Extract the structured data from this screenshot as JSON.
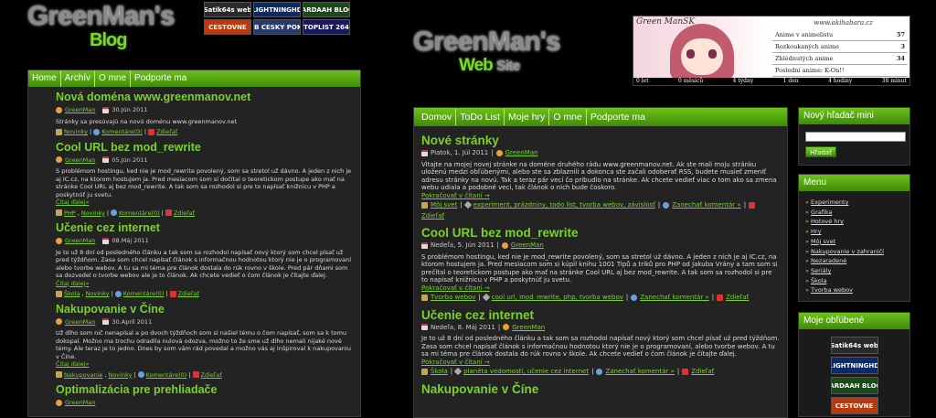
{
  "left": {
    "logo": {
      "line1": "GreenMan's",
      "line2": "Blog"
    },
    "badges": [
      "Satik64s web",
      "LIGHTNINGHD",
      "JARDAAH BLOG",
      "CESTOVNE",
      "WEB CESKY POKER",
      "TOPLIST 264"
    ],
    "nav": [
      "Home",
      "Archív",
      "O mne",
      "Podporte ma"
    ],
    "posts": [
      {
        "title": "Nová doména www.greenmanov.net",
        "author": "GreenMan",
        "date": "30.Jún 2011",
        "text": "Stránky sa presúvajú na novú doménu www.greenmanov.net",
        "link": "",
        "tags": [
          "Novinky",
          "Komentáre(0)",
          "Zdieľať"
        ]
      },
      {
        "title": "Cool URL bez mod_rewrite",
        "author": "GreenMan",
        "date": "05.Jún 2011",
        "text": "S problémom hostingu, ked nie je mod_rewrite povolený, som sa stretol už dávno. A jeden z nich je aj IC.cz, na ktorom hostujem ja. Pred mesiacom som si dočítal o teoretickom postupe ako mať na stránke Cool URL aj bez mod_rewrite. A tak som sa rozhodol si pre to napísať knižnicu v PHP a poskytnúť ju svetu.",
        "link": "Čítaj ďalej»",
        "tags": [
          "PHP",
          "Novinky",
          "Komentáre(0)",
          "Zdieľať"
        ]
      },
      {
        "title": "Učenie cez internet",
        "author": "GreenMan",
        "date": "08.Máj 2011",
        "text": "Je to už 8 dní od posledného článku a tak som sa rozhodol napísať nový ktorý som chcel písať už pred týždňom. Zasa som chcel napísať článok s informačnou hodnotou ktorý nie je o programovaní alebo tvorbe webov. A tu sa mi téma pre článok dostala do rúk rovno v škole. Pred pár dňami som sa dozvedel o tvorbe webov ale je to článok. Ak chcete vedieť o čom článok je čítajte ďalej.",
        "link": "Čítaj ďalej»",
        "tags": [
          "Škola",
          "Novinky",
          "Komentáre(0)",
          "Zdieľať"
        ]
      },
      {
        "title": "Nakupovanie v Číne",
        "author": "GreenMan",
        "date": "30.Apríl 2011",
        "text": "Už dlho som nič nenapísal a po dvoch týždňoch som si našiel tému o čom napísať, som sa k tomu dokopal. Možno ma trochu odradila nulová odozva, možno to že sme už dlho nemali nijaké nové témy. Ale teraz je to jedno. Dnes by som vám rád povedal a možno vás aj inšpiroval k nakupovaniu v Číne.",
        "link": "Čítaj ďalej»",
        "tags": [
          "Nakupovanie",
          "Novinky",
          "Komentáre(0)",
          "Zdieľať"
        ]
      },
      {
        "title": "Optimalizácia pre prehliadače",
        "author": "GreenMan",
        "date": "",
        "text": "",
        "link": "",
        "tags": []
      }
    ]
  },
  "right": {
    "logo": {
      "line1": "GreenMan's",
      "line2a": "Web",
      "line2b": "Site"
    },
    "banner": {
      "name": "Green ManSK",
      "url": "www.akihabara.cz",
      "rows": [
        [
          "Anime v animelistu",
          "57"
        ],
        [
          "Rozkoukaných anime",
          "3"
        ],
        [
          "Zhlédnutých anime",
          "34"
        ],
        [
          "Poslední anime: K-On!!",
          ""
        ]
      ],
      "scale": [
        "0 let",
        "0 měsíců",
        "4 týdny",
        "1 den",
        "4 hodiny",
        "38 minut"
      ]
    },
    "nav": [
      "Domov",
      "ToDo List",
      "Moje hry",
      "O mne",
      "Podporte ma"
    ],
    "posts": [
      {
        "title": "Nové stránky",
        "meta": "Piatok, 1. Júl 2011",
        "author": "GreenMan",
        "text": "Vitajte na mojej novej stránke na doméne druhého rádu www.greenmanov.net. Ak ste mali moju stránku uloženú medzi obľúbenými, alebo ste sa zblaznili a dokonca ste začali odoberať RSS, budete musieť zmeniť adresu stránky na novú. Tak a teraz pár vecí čo pribudlo na stránke. Ak chcete vedieť viac o tom ako sa zmena webu udiala a podobné veci, tak článok o nich bude čoskoro.",
        "link": "Pokračovať v čítaní →",
        "foot": [
          "Môj svet",
          "experiment, prázdniny, todo list, tvorba webov, závislosť",
          "Zanechať komentár »",
          "Zdieľať"
        ]
      },
      {
        "title": "Cool URL bez mod_rewrite",
        "meta": "Nedeľa, 5. Jún 2011",
        "author": "GreenMan",
        "text": "S problémom hostingu, ked nie je mod_rewrite povolený, som sa stretol už dávno. A jeden z nich je aj IC.cz, na ktorom hostujem ja. Pred mesiacom som si kúpil knihu 1001 Tipů a triků pro PHP od Jakuba Vrány a tam som si prečítal o teoretickom postupe ako mať na stránke Cool URL aj bez mod_rewrite. A tak som sa rozhodol si pre to napísať knižnicu v PHP a poskytnúť ju svetu.",
        "link": "Pokračovať v čítaní →",
        "foot": [
          "Tvorba webov",
          "cool url, mod_rewrite, php, tvorba webov",
          "Zanechať komentár »",
          "Zdieľať"
        ]
      },
      {
        "title": "Učenie cez internet",
        "meta": "Nedeľa, 8. Máj 2011",
        "author": "GreenMan",
        "text": "Je to už 8 dní od posledného článku a tak som sa rozhodol napísať nový ktorý som chcel písať už pred týždňom. Zasa som chcel napísať článok s informačnou hodnotou ktorý nie je o programovaní, alebo tvorbe webov. A tu sa mi téma pre článok dostala do rúk rovno v škole. Ak chcete vedieť o čom článok je čítajte ďalej.",
        "link": "Pokračovať v čítaní →",
        "foot": [
          "Škola",
          "planéta vedomostí, učenie cez internet",
          "Zanechať komentár »",
          "Zdieľať"
        ]
      },
      {
        "title": "Nakupovanie v Číne",
        "meta": "",
        "author": "",
        "text": "",
        "link": "",
        "foot": []
      }
    ],
    "search": {
      "title": "Nový hľadač mini",
      "button": "Hľadať",
      "value": ""
    },
    "menu": {
      "title": "Menu",
      "items": [
        "Experimenty",
        "Grafika",
        "Hotové hry",
        "Hry",
        "Môj svet",
        "Nakupovanie v zahraničí",
        "Nezaradené",
        "Seriály",
        "Škola",
        "Tvorba webov"
      ]
    },
    "favorites": {
      "title": "Moje obľúbené",
      "badges": [
        "Satik64s web",
        "LIGHTNINGHD",
        "JARDAAH BLOG",
        "CESTOVNE"
      ]
    }
  }
}
